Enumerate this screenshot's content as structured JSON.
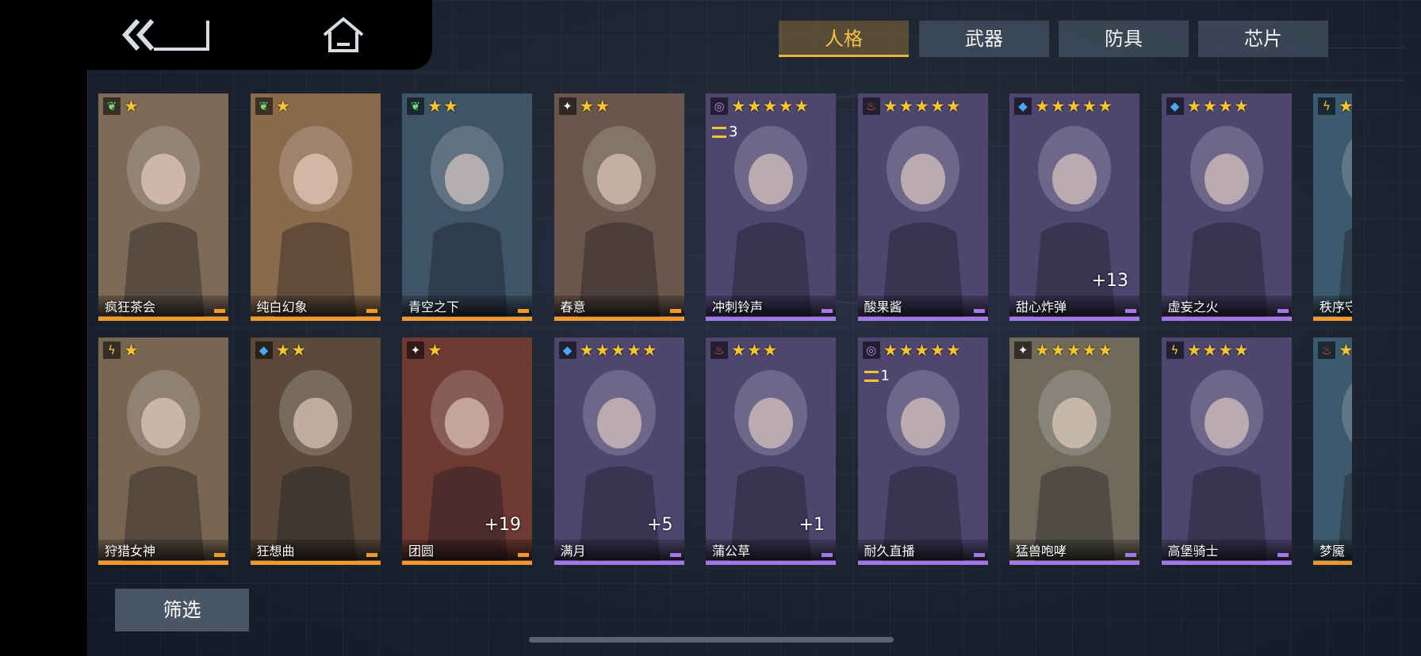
{
  "nav": {
    "back_icon": "double-chevron-back-icon",
    "home_icon": "home-icon"
  },
  "tabs": [
    {
      "label": "人格",
      "active": true
    },
    {
      "label": "武器",
      "active": false
    },
    {
      "label": "防具",
      "active": false
    },
    {
      "label": "芯片",
      "active": false
    }
  ],
  "colors": {
    "accent": "#e8b43d",
    "orange_rarity": "#ef9a2b",
    "purple_rarity": "#a577e6"
  },
  "cards": [
    {
      "name": "疯狂茶会",
      "element": "leaf",
      "stars": 1,
      "plus": "",
      "rank": "",
      "rarity": "orange",
      "bg": "#7d6a57"
    },
    {
      "name": "纯白幻象",
      "element": "leaf",
      "stars": 1,
      "plus": "",
      "rank": "",
      "rarity": "orange",
      "bg": "#8a6a4d"
    },
    {
      "name": "青空之下",
      "element": "leaf",
      "stars": 2,
      "plus": "",
      "rank": "",
      "rarity": "orange",
      "bg": "#3f5468"
    },
    {
      "name": "春意",
      "element": "spark",
      "stars": 2,
      "plus": "",
      "rank": "",
      "rarity": "orange",
      "bg": "#6a564c"
    },
    {
      "name": "冲刺铃声",
      "element": "spiral",
      "stars": 5,
      "plus": "",
      "rank": "3",
      "rarity": "purple",
      "bg": "#4f4670"
    },
    {
      "name": "酸果酱",
      "element": "fire",
      "stars": 5,
      "plus": "",
      "rank": "",
      "rarity": "purple",
      "bg": "#4f4670"
    },
    {
      "name": "甜心炸弹",
      "element": "water",
      "stars": 5,
      "plus": "+13",
      "rank": "",
      "rarity": "purple",
      "bg": "#4f4670"
    },
    {
      "name": "虚妄之火",
      "element": "water",
      "stars": 4,
      "plus": "",
      "rank": "",
      "rarity": "purple",
      "bg": "#4f4670"
    },
    {
      "name": "秩序守",
      "element": "bolt",
      "stars": 1,
      "plus": "",
      "rank": "",
      "rarity": "orange",
      "bg": "#3c5a6e"
    },
    {
      "name": "狩猎女神",
      "element": "bolt",
      "stars": 1,
      "plus": "",
      "rank": "",
      "rarity": "orange",
      "bg": "#786652"
    },
    {
      "name": "狂想曲",
      "element": "water",
      "stars": 2,
      "plus": "",
      "rank": "",
      "rarity": "orange",
      "bg": "#5b4a3a"
    },
    {
      "name": "团圆",
      "element": "spark",
      "stars": 1,
      "plus": "+19",
      "rank": "",
      "rarity": "orange",
      "bg": "#6e3a33"
    },
    {
      "name": "满月",
      "element": "water",
      "stars": 5,
      "plus": "+5",
      "rank": "",
      "rarity": "purple",
      "bg": "#4f4670"
    },
    {
      "name": "蒲公草",
      "element": "fire",
      "stars": 3,
      "plus": "+1",
      "rank": "",
      "rarity": "purple",
      "bg": "#4f4670"
    },
    {
      "name": "耐久直播",
      "element": "spiral",
      "stars": 5,
      "plus": "",
      "rank": "1",
      "rarity": "purple",
      "bg": "#4f4670"
    },
    {
      "name": "猛兽咆哮",
      "element": "spark",
      "stars": 5,
      "plus": "",
      "rank": "",
      "rarity": "purple",
      "bg": "#6f6a5c"
    },
    {
      "name": "高堡骑士",
      "element": "bolt",
      "stars": 4,
      "plus": "",
      "rank": "",
      "rarity": "purple",
      "bg": "#4f4670"
    },
    {
      "name": "梦魇",
      "element": "fire",
      "stars": 1,
      "plus": "",
      "rank": "",
      "rarity": "orange",
      "bg": "#3c5a6e"
    }
  ],
  "element_icons": {
    "leaf": {
      "glyph": "❦",
      "color": "#6fe07a",
      "icon": "leaf-element-icon"
    },
    "spark": {
      "glyph": "✦",
      "color": "#f4f4f4",
      "icon": "spark-element-icon"
    },
    "spiral": {
      "glyph": "◎",
      "color": "#c48cf2",
      "icon": "spiral-element-icon"
    },
    "fire": {
      "glyph": "♨",
      "color": "#ff5a3c",
      "icon": "fire-element-icon"
    },
    "water": {
      "glyph": "◆",
      "color": "#48a8f0",
      "icon": "water-element-icon"
    },
    "bolt": {
      "glyph": "ϟ",
      "color": "#f5d23b",
      "icon": "bolt-element-icon"
    }
  },
  "filter": {
    "label": "筛选"
  }
}
